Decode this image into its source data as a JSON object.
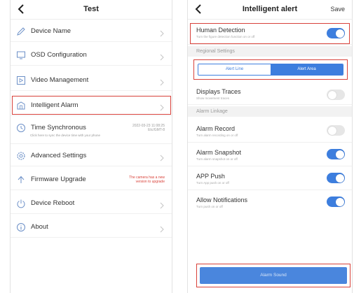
{
  "left": {
    "title": "Test",
    "items": [
      {
        "label": "Device Name",
        "icon": "pencil-icon"
      },
      {
        "label": "OSD Configuration",
        "icon": "monitor-icon"
      },
      {
        "label": "Video Management",
        "icon": "video-file-icon"
      },
      {
        "label": "Intelligent Alarm",
        "icon": "building-icon"
      },
      {
        "label": "Time Synchronous",
        "icon": "clock-icon",
        "sub": "Click here to sync the device time with your phone",
        "time_line1": "2022-03-23 11:08:25",
        "time_line2": "Etc/GMT-8"
      },
      {
        "label": "Advanced Settings",
        "icon": "gear-icon"
      },
      {
        "label": "Firmware Upgrade",
        "icon": "upload-icon",
        "note_line1": "The camera has a new",
        "note_line2": "version to upgrade"
      },
      {
        "label": "Device Reboot",
        "icon": "power-icon"
      },
      {
        "label": "About",
        "icon": "info-icon"
      }
    ]
  },
  "right": {
    "title": "Intelligent alert",
    "save_label": "Save",
    "human_detection": {
      "label": "Human Detection",
      "sub": "Turn the figure detection function on or off",
      "on": true
    },
    "regional_settings": "Regional Settings",
    "segment": {
      "option1": "Alert Line",
      "option2": "Alert Area",
      "selected": "Alert Area"
    },
    "displays_traces": {
      "label": "Displays Traces",
      "sub": "Show movement traces",
      "on": false
    },
    "alarm_linkage": "Alarm Linkage",
    "alarm_record": {
      "label": "Alarm Record",
      "sub": "Turn alarm recording on or off",
      "on": false
    },
    "alarm_snapshot": {
      "label": "Alarm Snapshot",
      "sub": "Turn alarm snapshot on or off",
      "on": true
    },
    "app_push": {
      "label": "APP Push",
      "sub": "Turn App push on or off",
      "on": true
    },
    "allow_notifications": {
      "label": "Allow Notifications",
      "sub": "Turn push on or off",
      "on": true
    },
    "alarm_sound": "Alarm Sound"
  },
  "colors": {
    "accent": "#3d7ede",
    "highlight": "#d8413a",
    "note_red": "#d9433b"
  }
}
